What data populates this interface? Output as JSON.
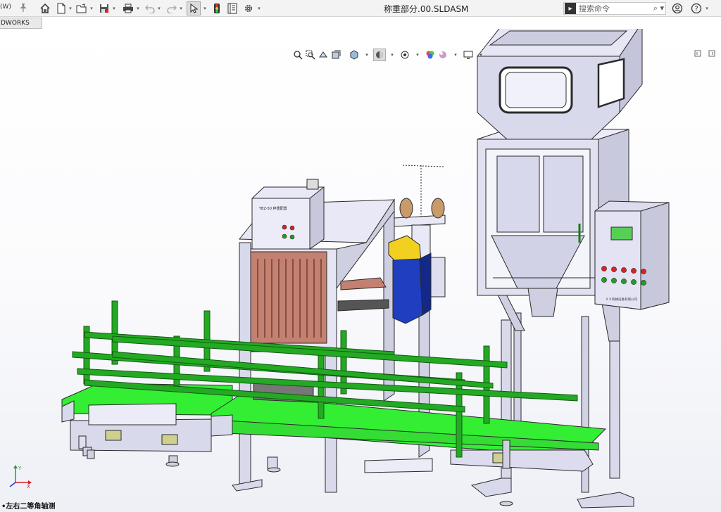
{
  "app": {
    "menu_label": "(W)",
    "document_title": "称重部分.00.SLDASM",
    "tab_label": "DWORKS CAM"
  },
  "search": {
    "placeholder": "搜索命令",
    "icon": "solidworks-search-icon"
  },
  "toolbar": {
    "icons": [
      "pin-icon",
      "home-icon",
      "new-document-icon",
      "open-icon",
      "save-icon",
      "print-icon",
      "undo-icon",
      "redo-icon",
      "select-arrow-icon",
      "traffic-light-icon",
      "file-properties-icon",
      "options-gear-icon"
    ]
  },
  "hud_toolbar": {
    "icons": [
      "zoom-to-fit-icon",
      "zoom-to-area-icon",
      "previous-view-icon",
      "section-view-icon",
      "view-orientation-icon",
      "display-style-icon",
      "hide-show-items-icon",
      "edit-appearance-icon",
      "apply-scene-icon",
      "view-settings-icon"
    ]
  },
  "right_controls": [
    "user-account-icon",
    "help-icon"
  ],
  "viewport": {
    "view_label": "•左右二等角轴测",
    "panels": {
      "control_box_small": "YBZ-50 秤重配置",
      "control_box_main": "ＸＸ机械设备有限公司"
    }
  },
  "colors": {
    "frame": "#d9d9ec",
    "frame_stroke": "#2a2a2a",
    "conveyor_belt": "#33ee33",
    "guard_rail": "#22aa22",
    "grille": "#c48070",
    "sewing_yellow": "#f2d020",
    "sewing_blue": "#1f3fc0",
    "bobbin": "#c99a6a",
    "screen_green": "#55d055",
    "led_red": "#e02020",
    "led_green": "#20a020"
  }
}
